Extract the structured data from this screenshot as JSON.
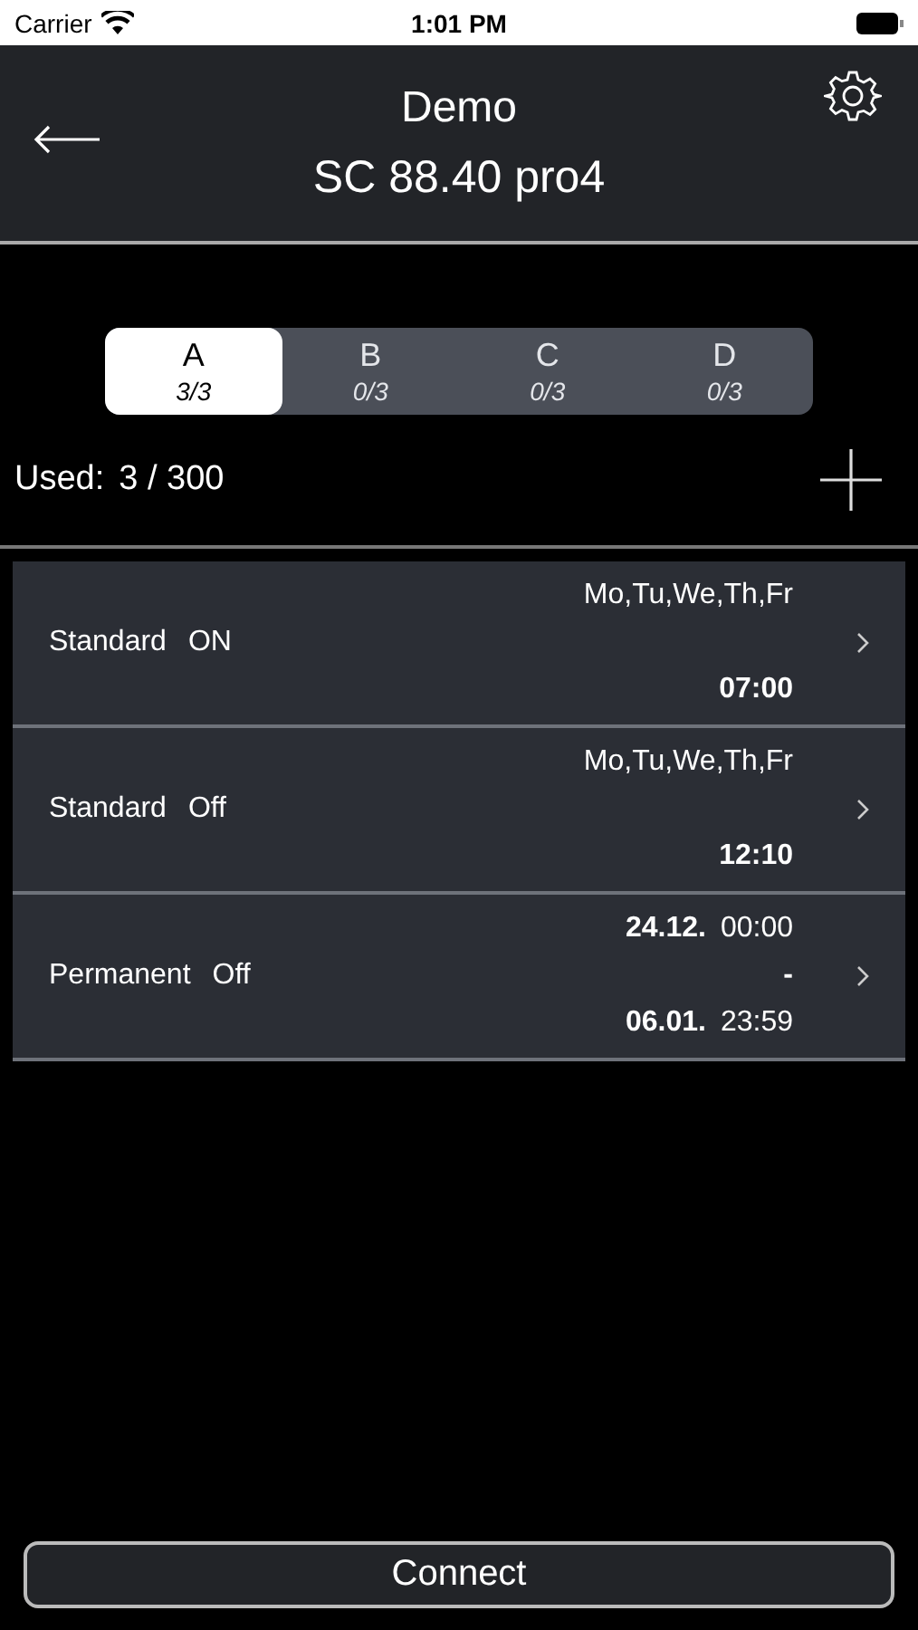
{
  "status_bar": {
    "carrier": "Carrier",
    "time": "1:01 PM"
  },
  "header": {
    "title": "Demo",
    "subtitle": "SC 88.40 pro4"
  },
  "tabs": [
    {
      "label": "A",
      "count": "3/3",
      "selected": true
    },
    {
      "label": "B",
      "count": "0/3",
      "selected": false
    },
    {
      "label": "C",
      "count": "0/3",
      "selected": false
    },
    {
      "label": "D",
      "count": "0/3",
      "selected": false
    }
  ],
  "usage": {
    "label": "Used:",
    "value": "3 / 300"
  },
  "entries": [
    {
      "kind": "weekly",
      "type": "Standard",
      "state": "ON",
      "days": "Mo,Tu,We,Th,Fr",
      "time": "07:00"
    },
    {
      "kind": "weekly",
      "type": "Standard",
      "state": "Off",
      "days": "Mo,Tu,We,Th,Fr",
      "time": "12:10"
    },
    {
      "kind": "period",
      "type": "Permanent",
      "state": "Off",
      "start_date": "24.12.",
      "start_time": "00:00",
      "separator": "-",
      "end_date": "06.01.",
      "end_time": "23:59"
    }
  ],
  "connect_button": "Connect"
}
